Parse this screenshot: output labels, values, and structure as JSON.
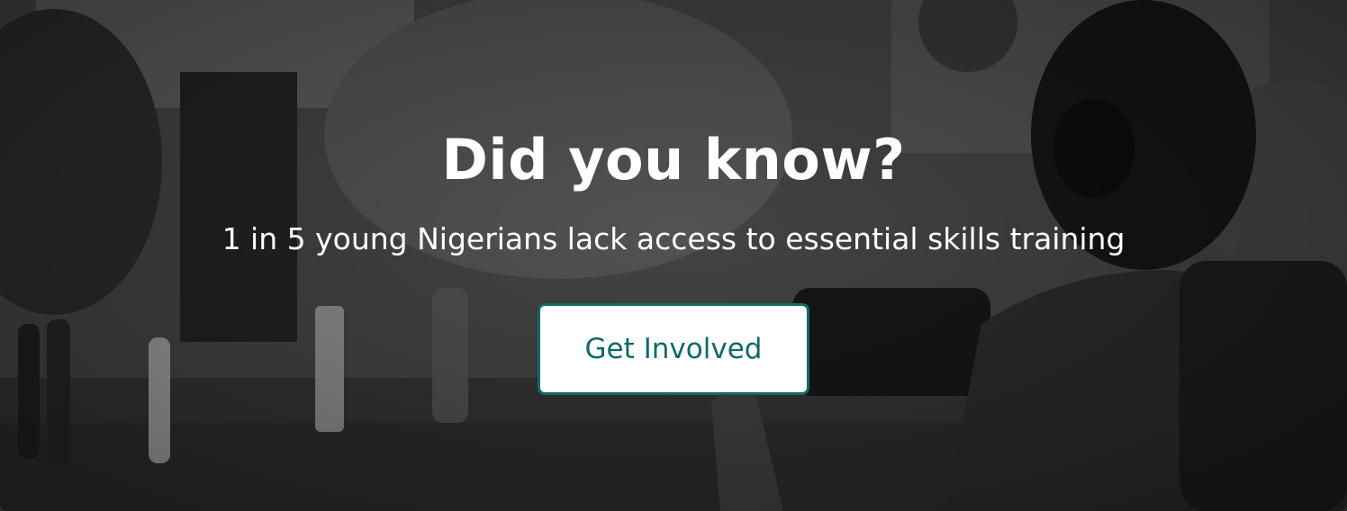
{
  "banner": {
    "headline": "Did you know?",
    "subtext": "1 in 5 young Nigerians lack access to essential skills training",
    "cta_label": "Get Involved"
  },
  "colors": {
    "accent": "#0e6b68",
    "text": "#ffffff",
    "button_bg": "#ffffff"
  },
  "background": {
    "description_icon": "street-photo-icon"
  }
}
